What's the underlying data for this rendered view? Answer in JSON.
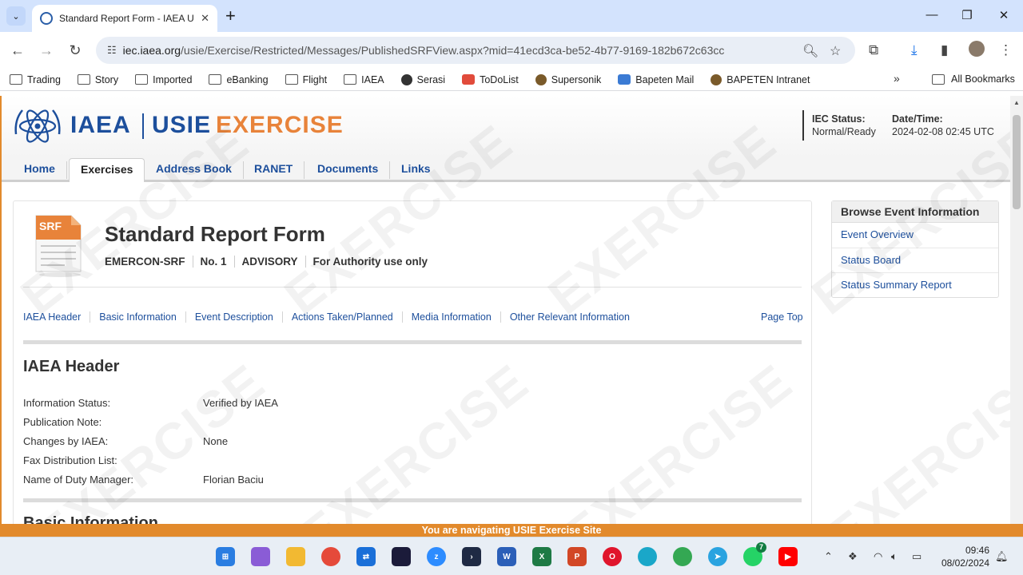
{
  "browser": {
    "tab_title": "Standard Report Form - IAEA U",
    "url_host": "iec.iaea.org",
    "url_path": "/usie/Exercise/Restricted/Messages/PublishedSRFView.aspx?mid=41ecd3ca-be52-4b77-9169-182b672c63cc",
    "bookmarks": [
      "Trading",
      "Story",
      "Imported",
      "eBanking",
      "Flight",
      "IAEA",
      "Serasi",
      "ToDoList",
      "Supersonik",
      "Bapeten Mail",
      "BAPETEN Intranet"
    ],
    "all_bookmarks": "All Bookmarks"
  },
  "header": {
    "logo_iaea": "IAEA",
    "logo_usie": "USIE",
    "logo_exercise": "EXERCISE",
    "status_label": "IEC Status:",
    "status_value": "Normal/Ready",
    "datetime_label": "Date/Time:",
    "datetime_value": "2024-02-08 02:45 UTC"
  },
  "nav": [
    "Home",
    "Exercises",
    "Address Book",
    "RANET",
    "Documents",
    "Links"
  ],
  "form": {
    "icon_text": "SRF",
    "title": "Standard Report Form",
    "meta": [
      "EMERCON-SRF",
      "No. 1",
      "ADVISORY",
      "For Authority use only"
    ],
    "sections": [
      "IAEA Header",
      "Basic Information",
      "Event Description",
      "Actions Taken/Planned",
      "Media Information",
      "Other Relevant Information"
    ],
    "page_top": "Page Top",
    "section_title": "IAEA Header",
    "rows": [
      {
        "label": "Information Status:",
        "value": "Verified by IAEA"
      },
      {
        "label": "Publication Note:",
        "value": ""
      },
      {
        "label": "Changes by IAEA:",
        "value": "None"
      },
      {
        "label": "Fax Distribution List:",
        "value": ""
      },
      {
        "label": "Name of Duty Manager:",
        "value": "Florian Baciu"
      }
    ],
    "next_section_title": "Basic Information"
  },
  "sidebar": {
    "title": "Browse Event Information",
    "items": [
      "Event Overview",
      "Status Board",
      "Status Summary Report"
    ]
  },
  "watermark": "EXERCISE",
  "banner": "You are navigating USIE Exercise Site",
  "taskbar": {
    "time": "09:46",
    "date": "08/02/2024",
    "whatsapp_badge": "7"
  },
  "colors": {
    "accent_blue": "#1d4f9c",
    "accent_orange": "#e28a2c"
  }
}
